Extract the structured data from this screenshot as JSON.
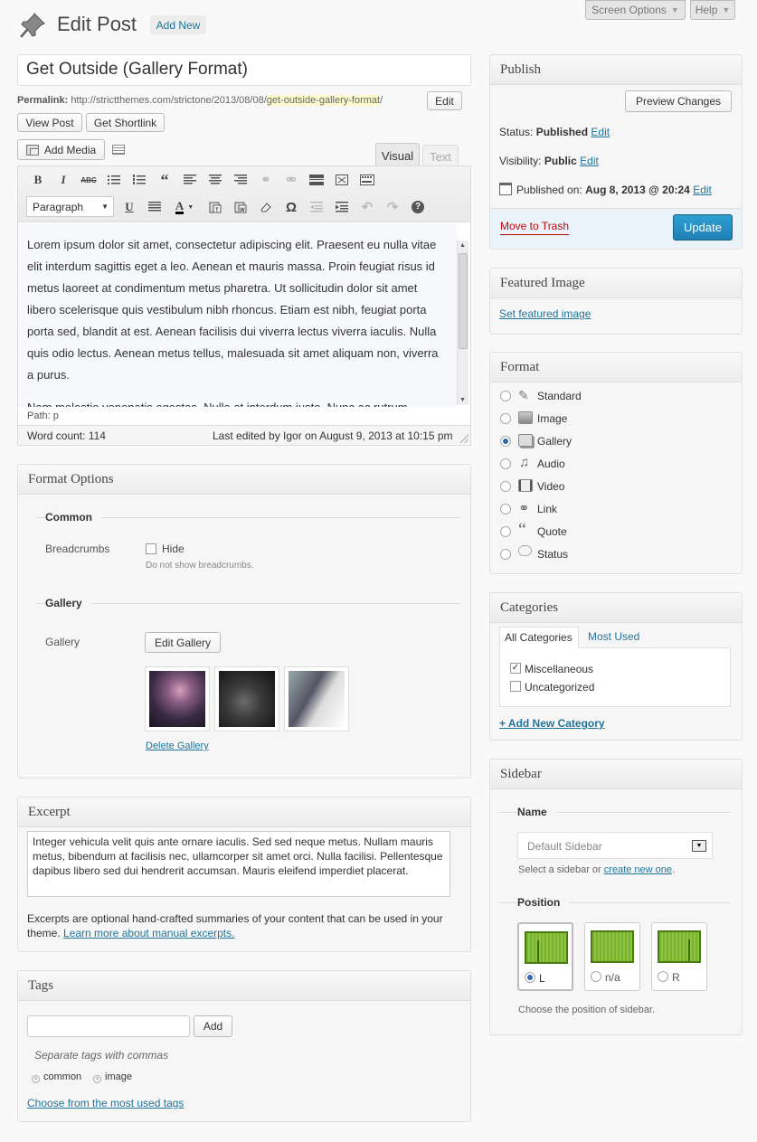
{
  "header": {
    "title": "Edit Post",
    "add_new": "Add New",
    "screen_options": "Screen Options",
    "help": "Help"
  },
  "post": {
    "title": "Get Outside (Gallery Format)",
    "permalink_label": "Permalink:",
    "permalink_base": "http://strictthemes.com/strictone/2013/08/08/",
    "permalink_slug": "get-outside-gallery-format",
    "permalink_tail": "/",
    "edit": "Edit",
    "view_post": "View Post",
    "get_shortlink": "Get Shortlink"
  },
  "editor": {
    "add_media": "Add Media",
    "tab_visual": "Visual",
    "tab_text": "Text",
    "paragraph": "Paragraph",
    "content_p1": "Lorem ipsum dolor sit amet, consectetur adipiscing elit. Praesent eu nulla vitae elit interdum sagittis eget a leo. Aenean et mauris massa. Proin feugiat risus id metus laoreet at condimentum metus pharetra. Ut sollicitudin dolor sit amet libero scelerisque quis vestibulum nibh rhoncus. Etiam est nibh, feugiat porta porta sed, blandit at est. Aenean facilisis dui viverra lectus viverra iaculis. Nulla quis odio lectus. Aenean metus tellus, malesuada sit amet aliquam non, viverra a purus.",
    "content_p2": "Nam molestie venenatis egestas. Nulla at interdum justo. Nunc ac rutrum",
    "path": "Path: p",
    "word_count": "Word count: 114",
    "last_edited": "Last edited by Igor on August 9, 2013 at 10:15 pm"
  },
  "format_options": {
    "title": "Format Options",
    "common": "Common",
    "breadcrumbs_label": "Breadcrumbs",
    "hide": "Hide",
    "hide_desc": "Do not show breadcrumbs.",
    "gallery_section": "Gallery",
    "gallery_label": "Gallery",
    "edit_gallery": "Edit Gallery",
    "delete_gallery": "Delete Gallery"
  },
  "excerpt": {
    "title": "Excerpt",
    "text": "Integer vehicula velit quis ante ornare iaculis. Sed sed neque metus. Nullam mauris metus, bibendum at facilisis nec, ullamcorper sit amet orci. Nulla facilisi. Pellentesque dapibus libero sed dui hendrerit accumsan. Mauris eleifend imperdiet placerat.",
    "help": "Excerpts are optional hand-crafted summaries of your content that can be used in your theme.",
    "learn_more": "Learn more about manual excerpts."
  },
  "tags": {
    "title": "Tags",
    "add": "Add",
    "hint": "Separate tags with commas",
    "items": [
      "common",
      "image"
    ],
    "choose": "Choose from the most used tags"
  },
  "publish": {
    "title": "Publish",
    "preview": "Preview Changes",
    "status_label": "Status:",
    "status_value": "Published",
    "visibility_label": "Visibility:",
    "visibility_value": "Public",
    "published_on_label": "Published on:",
    "published_on_value": "Aug 8, 2013 @ 20:24",
    "edit": "Edit",
    "trash": "Move to Trash",
    "update": "Update"
  },
  "featured_image": {
    "title": "Featured Image",
    "link": "Set featured image"
  },
  "format": {
    "title": "Format",
    "options": [
      "Standard",
      "Image",
      "Gallery",
      "Audio",
      "Video",
      "Link",
      "Quote",
      "Status"
    ],
    "selected": "Gallery"
  },
  "categories": {
    "title": "Categories",
    "tab_all": "All Categories",
    "tab_used": "Most Used",
    "items": [
      {
        "label": "Miscellaneous",
        "checked": true
      },
      {
        "label": "Uncategorized",
        "checked": false
      }
    ],
    "add_new": "+ Add New Category"
  },
  "sidebar": {
    "title": "Sidebar",
    "name_label": "Name",
    "select_value": "Default Sidebar",
    "select_hint_prefix": "Select a sidebar or",
    "create_link": "create new one",
    "select_hint_suffix": ".",
    "position_label": "Position",
    "positions": [
      "L",
      "n/a",
      "R"
    ],
    "selected_position": "L",
    "position_hint": "Choose the position of sidebar."
  },
  "colors": {
    "link": "#21759b",
    "update_button": "#2e8bc7",
    "trash": "#bc0b0b",
    "slug_highlight": "#fffbcc"
  }
}
